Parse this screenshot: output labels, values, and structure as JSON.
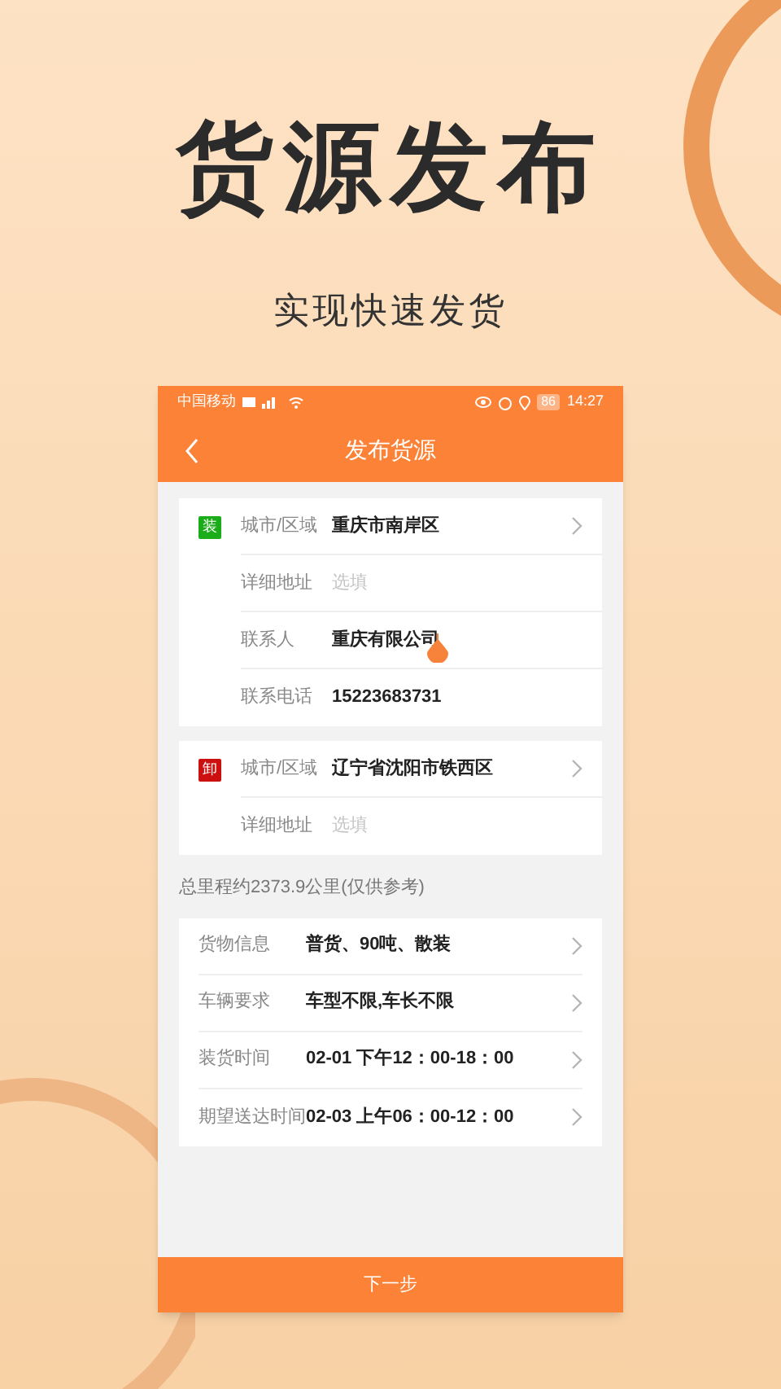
{
  "hero": {
    "title": "货源发布",
    "subtitle": "实现快速发货"
  },
  "status_bar": {
    "carrier": "中国移动",
    "battery": "86",
    "time": "14:27"
  },
  "nav": {
    "title": "发布货源"
  },
  "address_cards": [
    {
      "badge": "装",
      "color": "#1aad19",
      "rows": [
        {
          "label": "城市/区域",
          "value": "重庆市南岸区",
          "kind": "select",
          "focused": false
        },
        {
          "label": "详细地址",
          "placeholder": "选填",
          "kind": "input",
          "focused": false
        },
        {
          "label": "联系人",
          "value": "重庆有限公司",
          "kind": "input",
          "focused": true
        },
        {
          "label": "联系电话",
          "value": "15223683731",
          "kind": "input",
          "focused": false
        }
      ]
    },
    {
      "badge": "卸",
      "color": "#cc1010",
      "rows": [
        {
          "label": "城市/区域",
          "value": "辽宁省沈阳市铁西区",
          "kind": "select",
          "focused": false
        },
        {
          "label": "详细地址",
          "placeholder": "选填",
          "kind": "input",
          "focused": false
        }
      ]
    }
  ],
  "distance_note": "总里程约2373.9公里(仅供参考)",
  "detail_rows": [
    {
      "label": "货物信息",
      "value": "普货、90吨、散装"
    },
    {
      "label": "车辆要求",
      "value": "车型不限,车长不限"
    },
    {
      "label": "装货时间",
      "value": "02-01 下午12：00-18：00"
    },
    {
      "label": "期望送达时间",
      "value": "02-03 上午06：00-12：00"
    }
  ],
  "next_button": "下一步"
}
